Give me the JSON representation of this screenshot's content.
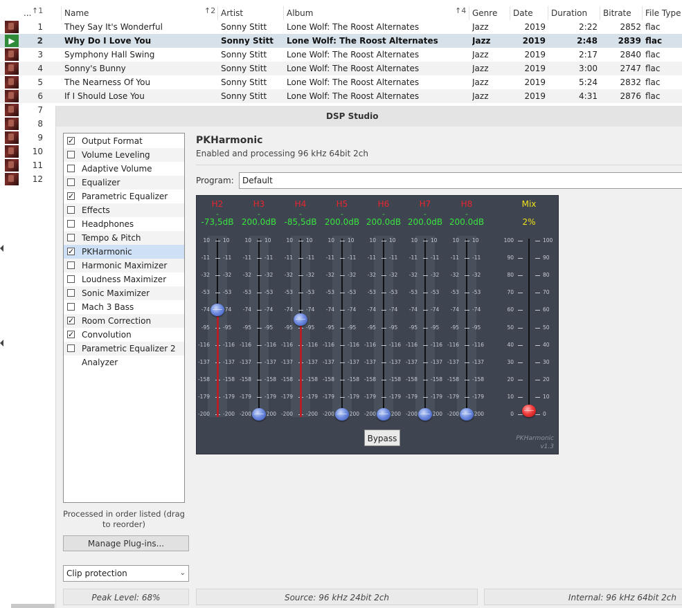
{
  "playlist": {
    "headers": [
      {
        "label": "...",
        "sort": "1"
      },
      {
        "label": "Name",
        "sort": "2"
      },
      {
        "label": "Artist",
        "sort": ""
      },
      {
        "label": "Album",
        "sort": "4"
      },
      {
        "label": "Genre",
        "sort": ""
      },
      {
        "label": "Date",
        "sort": ""
      },
      {
        "label": "Duration",
        "sort": ""
      },
      {
        "label": "Bitrate",
        "sort": ""
      },
      {
        "label": "File Type",
        "sort": ""
      }
    ],
    "rows": [
      {
        "num": "1",
        "name": "They Say It's Wonderful",
        "artist": "Sonny Stitt",
        "album": "Lone Wolf: The Roost Alternates",
        "genre": "Jazz",
        "date": "2019",
        "duration": "2:22",
        "bitrate": "2852",
        "filetype": "flac"
      },
      {
        "num": "2",
        "name": "Why Do I Love You",
        "artist": "Sonny Stitt",
        "album": "Lone Wolf: The Roost Alternates",
        "genre": "Jazz",
        "date": "2019",
        "duration": "2:48",
        "bitrate": "2839",
        "filetype": "flac"
      },
      {
        "num": "3",
        "name": "Symphony Hall Swing",
        "artist": "Sonny Stitt",
        "album": "Lone Wolf: The Roost Alternates",
        "genre": "Jazz",
        "date": "2019",
        "duration": "2:17",
        "bitrate": "2840",
        "filetype": "flac"
      },
      {
        "num": "4",
        "name": "Sonny's Bunny",
        "artist": "Sonny Stitt",
        "album": "Lone Wolf: The Roost Alternates",
        "genre": "Jazz",
        "date": "2019",
        "duration": "3:00",
        "bitrate": "2747",
        "filetype": "flac"
      },
      {
        "num": "5",
        "name": "The Nearness Of You",
        "artist": "Sonny Stitt",
        "album": "Lone Wolf: The Roost Alternates",
        "genre": "Jazz",
        "date": "2019",
        "duration": "5:24",
        "bitrate": "2832",
        "filetype": "flac"
      },
      {
        "num": "6",
        "name": "If I Should Lose You",
        "artist": "Sonny Stitt",
        "album": "Lone Wolf: The Roost Alternates",
        "genre": "Jazz",
        "date": "2019",
        "duration": "4:31",
        "bitrate": "2876",
        "filetype": "flac"
      }
    ],
    "extra_nums": [
      "7",
      "8",
      "9",
      "10",
      "11",
      "12"
    ],
    "playing_index": 1
  },
  "dsp": {
    "title": "DSP Studio",
    "plugins": [
      {
        "label": "Output Format",
        "checked": true
      },
      {
        "label": "Volume Leveling",
        "checked": false
      },
      {
        "label": "Adaptive Volume",
        "checked": false
      },
      {
        "label": "Equalizer",
        "checked": false
      },
      {
        "label": "Parametric Equalizer",
        "checked": true
      },
      {
        "label": "Effects",
        "checked": false
      },
      {
        "label": "Headphones",
        "checked": false
      },
      {
        "label": "Tempo & Pitch",
        "checked": false
      },
      {
        "label": "PKHarmonic",
        "checked": true
      },
      {
        "label": "Harmonic Maximizer",
        "checked": false
      },
      {
        "label": "Loudness Maximizer",
        "checked": false
      },
      {
        "label": "Sonic Maximizer",
        "checked": false
      },
      {
        "label": "Mach 3 Bass",
        "checked": false
      },
      {
        "label": "Room Correction",
        "checked": true
      },
      {
        "label": "Convolution",
        "checked": true
      },
      {
        "label": "Parametric Equalizer 2",
        "checked": false
      },
      {
        "label": "Analyzer",
        "checked": null
      }
    ],
    "selected_plugin_index": 8,
    "order_note": "Processed in order listed (drag to reorder)",
    "manage_label": "Manage Plug-ins...",
    "clip_option": "Clip protection",
    "plugin_name": "PKHarmonic",
    "plugin_status": "Enabled and processing 96 kHz 64bit 2ch",
    "program_label": "Program:",
    "program_value": "Default",
    "peak_level": "Peak Level: 68%",
    "source": "Source: 96 kHz 24bit 2ch",
    "internal": "Internal: 96 kHz 64bit 2ch"
  },
  "pkharmonic": {
    "channels": [
      {
        "name": "H2",
        "value_text": "-73,5dB",
        "level_db": -73.5
      },
      {
        "name": "H3",
        "value_text": "200.0dB",
        "level_db": -200
      },
      {
        "name": "H4",
        "value_text": "-85,5dB",
        "level_db": -85.5
      },
      {
        "name": "H5",
        "value_text": "200.0dB",
        "level_db": -200
      },
      {
        "name": "H6",
        "value_text": "200.0dB",
        "level_db": -200
      },
      {
        "name": "H7",
        "value_text": "200.0dB",
        "level_db": -200
      },
      {
        "name": "H8",
        "value_text": "200.0dB",
        "level_db": -200
      }
    ],
    "db_ticks": [
      "10",
      "-11",
      "-32",
      "-53",
      "-74",
      "-95",
      "-116",
      "-137",
      "-158",
      "-179",
      "-200"
    ],
    "mix": {
      "name": "Mix",
      "value_text": "2%",
      "level_pct": 2
    },
    "mix_ticks": [
      "100",
      "90",
      "80",
      "70",
      "60",
      "50",
      "40",
      "30",
      "20",
      "10",
      "0"
    ],
    "bypass_label": "Bypass",
    "brand": "PKHarmonic",
    "version": "v1.3",
    "colors": {
      "channel_name": "#e8262e",
      "value_green": "#39e43f",
      "mix_yellow": "#f1e21b",
      "panel_bg": "#3e4450"
    }
  }
}
